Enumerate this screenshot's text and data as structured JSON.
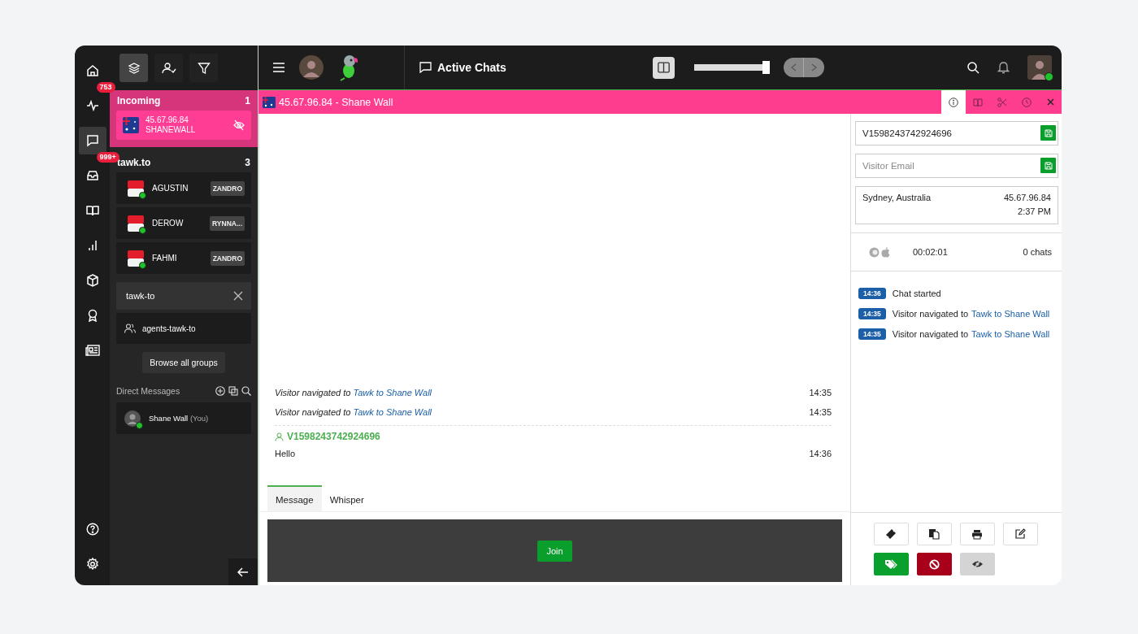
{
  "rail": {
    "items": [
      {
        "selected": false
      },
      {
        "selected": false,
        "badge": "753"
      },
      {
        "selected": true
      },
      {
        "selected": false,
        "badge": "999+"
      },
      {
        "selected": false
      },
      {
        "selected": false
      },
      {
        "selected": false
      },
      {
        "selected": false
      },
      {
        "selected": false
      }
    ]
  },
  "list_toolbar": [
    {
      "selected": true
    },
    {
      "selected": false
    },
    {
      "selected": false
    }
  ],
  "incoming": {
    "title": "Incoming",
    "count": "1",
    "items": [
      {
        "ip": "45.67.96.84",
        "name": "SHANEWALL",
        "selected": true
      }
    ]
  },
  "group": {
    "title": "tawk.to",
    "count": "3",
    "chats": [
      {
        "name": "AGUSTIN",
        "agent": "ZANDRO",
        "online": true
      },
      {
        "name": "DEROW",
        "agent": "RYNNA...",
        "online": true
      },
      {
        "name": "FAHMI",
        "agent": "ZANDRO",
        "online": true
      }
    ]
  },
  "group_search": {
    "value": "tawk-to"
  },
  "group_results": [
    "agents-tawk-to"
  ],
  "browse_button": "Browse all groups",
  "direct_messages": {
    "title": "Direct Messages",
    "items": [
      {
        "name": "Shane Wall",
        "suffix": "(You)",
        "online": true
      }
    ]
  },
  "topbar": {
    "title": "Active Chats",
    "zoom": {
      "level": 1
    }
  },
  "chat": {
    "title": "45.67.96.84 - Shane Wall",
    "panel_tabs": [
      {
        "selected": true
      },
      {
        "selected": false
      },
      {
        "selected": false
      },
      {
        "selected": false
      }
    ],
    "events": [
      {
        "text": "Visitor navigated to",
        "link": "Tawk to Shane Wall",
        "time": "14:35"
      },
      {
        "text": "Visitor navigated to",
        "link": "Tawk to Shane Wall",
        "time": "14:35"
      }
    ],
    "messages": [
      {
        "sender": "V1598243742924696",
        "text": "Hello",
        "time": "14:36"
      }
    ],
    "composer_tabs": [
      {
        "label": "Message",
        "selected": true
      },
      {
        "label": "Whisper",
        "selected": false
      }
    ],
    "join_button": "Join"
  },
  "visitor": {
    "name_field": {
      "value": "V1598243742924696"
    },
    "email_field": {
      "placeholder": "Visitor Email"
    },
    "location": "Sydney, Australia",
    "ip": "45.67.96.84",
    "local_time": "2:37 PM",
    "duration": "00:02:01",
    "chats": "0 chats",
    "timeline": [
      {
        "time": "14:36",
        "text": "Chat started"
      },
      {
        "time": "14:35",
        "text": "Visitor navigated to",
        "link": "Tawk to Shane Wall"
      },
      {
        "time": "14:35",
        "text": "Visitor navigated to",
        "link": "Tawk to Shane Wall"
      }
    ]
  }
}
